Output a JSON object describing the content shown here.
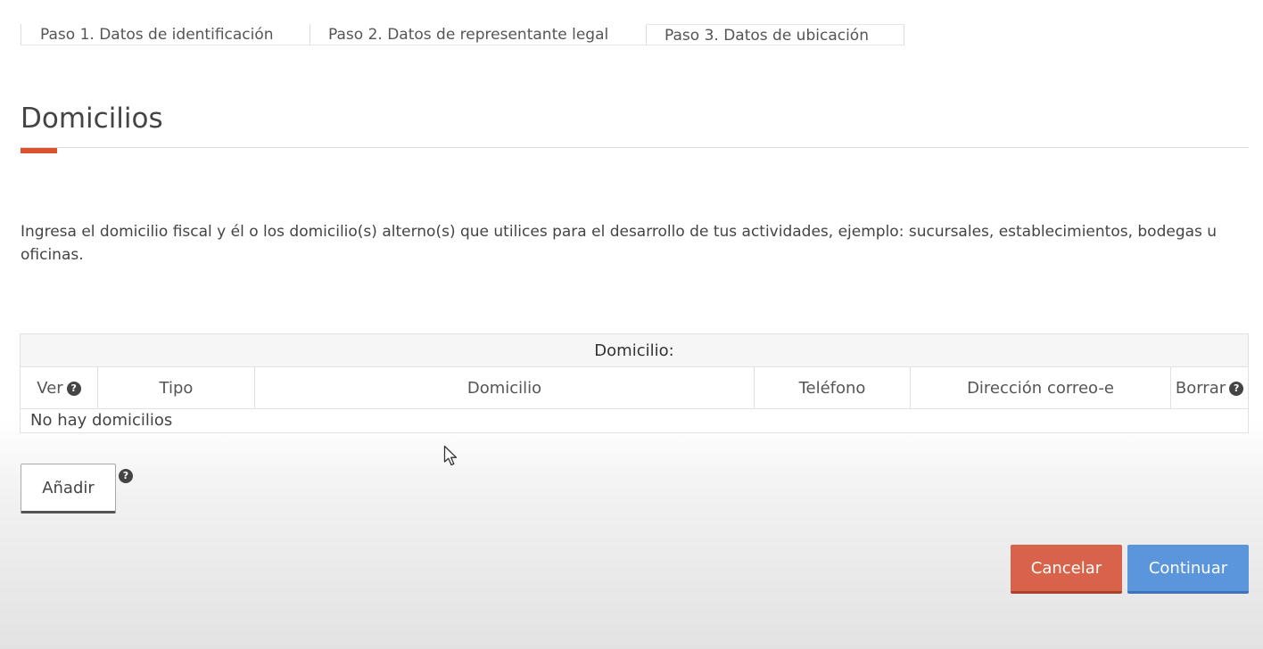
{
  "steps": [
    {
      "label": "Paso 1. Datos de identificación"
    },
    {
      "label": "Paso 2. Datos de representante legal"
    },
    {
      "label": "Paso 3. Datos de ubicación"
    }
  ],
  "section": {
    "title": "Domicilios",
    "accent_color": "#d9542e",
    "description": "Ingresa el domicilio fiscal y él o los domicilio(s) alterno(s) que utilices para el desarrollo de tus actividades, ejemplo: sucursales, establecimientos, bodegas u oficinas."
  },
  "table": {
    "caption": "Domicilio:",
    "columns": [
      "Ver",
      "Tipo",
      "Domicilio",
      "Teléfono",
      "Dirección correo-e",
      "Borrar"
    ],
    "empty_message": "No hay domicilios",
    "help_glyph": "?"
  },
  "buttons": {
    "add_label": "Añadir",
    "cancel_label": "Cancelar",
    "continue_label": "Continuar",
    "cancel_color": "#d9634a",
    "continue_color": "#5b95dc"
  }
}
